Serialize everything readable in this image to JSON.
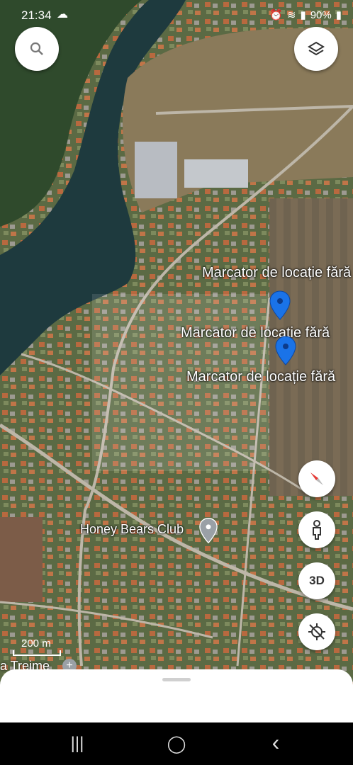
{
  "status_bar": {
    "time": "21:34",
    "battery": "90%",
    "icons": [
      "cloud-icon",
      "alarm-icon",
      "clock-icon",
      "wifi-icon",
      "call-icon",
      "signal-icon",
      "battery-icon"
    ]
  },
  "map": {
    "markers": [
      {
        "label": "Marcator de locație fără"
      },
      {
        "label": "Marcator de locație fără"
      },
      {
        "label": "Marcator de locație fără"
      }
    ],
    "poi_label": "Honey Bears Club",
    "partial_label": "a Treime",
    "scale_label": "200 m"
  },
  "buttons": {
    "search_icon": "search-icon",
    "layers_icon": "layers-icon",
    "compass_icon": "compass-icon",
    "street_view_icon": "pegman-icon",
    "view_3d_label": "3D",
    "location_icon": "location-off-icon"
  },
  "nav_bar": {
    "recents": "|||",
    "home": "◯",
    "back": "‹"
  },
  "colors": {
    "marker_blue": "#1a73e8",
    "compass_red": "#e53935",
    "poi_grey": "#9aa0a6"
  }
}
